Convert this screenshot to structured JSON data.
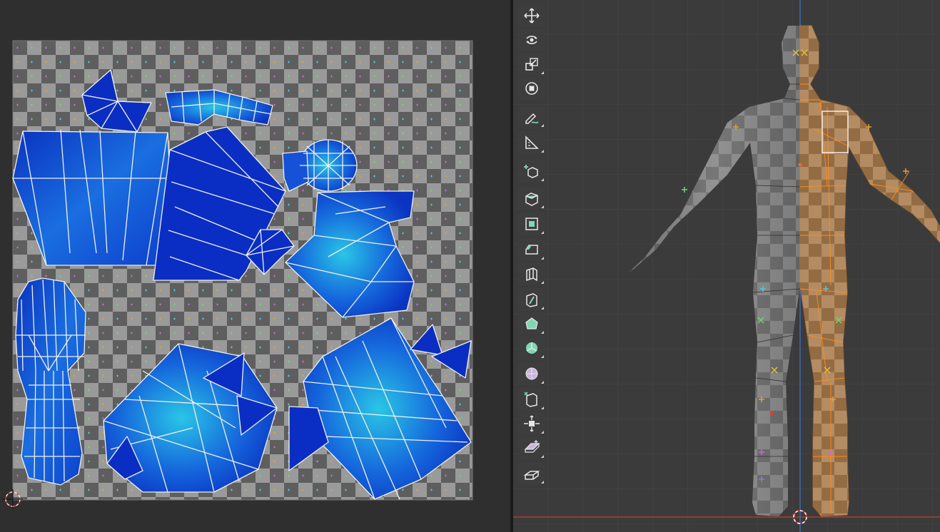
{
  "uv_editor": {
    "checker_colors": [
      "#9a9a9a",
      "#5e5e5e"
    ],
    "island_fill": "#1144cc",
    "island_highlight": "#22bbe0"
  },
  "viewport": {
    "grid_color": "#474747",
    "x_axis_color": "#c83a3a",
    "z_axis_color": "#3f72c9",
    "selection_color": "#ff8c1a"
  },
  "toolbar": {
    "tools": [
      {
        "icon": "move-icon",
        "active": false
      },
      {
        "icon": "rotate-icon",
        "active": false
      },
      {
        "icon": "scale-icon",
        "active": false
      },
      {
        "icon": "transform-icon",
        "active": false
      },
      {
        "icon": "annotate-icon",
        "active": false
      },
      {
        "icon": "measure-icon",
        "active": false
      },
      {
        "icon": "add-cube-icon",
        "active": false
      },
      {
        "icon": "extrude-region-icon",
        "active": false
      },
      {
        "icon": "inset-faces-icon",
        "active": false
      },
      {
        "icon": "bevel-icon",
        "active": false
      },
      {
        "icon": "loop-cut-icon",
        "active": false
      },
      {
        "icon": "knife-icon",
        "active": false
      },
      {
        "icon": "poly-build-icon",
        "active": false
      },
      {
        "icon": "spin-icon",
        "active": false
      },
      {
        "icon": "smooth-vertices-icon",
        "active": false
      },
      {
        "icon": "edge-slide-icon",
        "active": false
      },
      {
        "icon": "shrink-fatten-icon",
        "active": false
      },
      {
        "icon": "shear-icon",
        "active": false
      },
      {
        "icon": "rip-region-icon",
        "active": false
      }
    ]
  }
}
